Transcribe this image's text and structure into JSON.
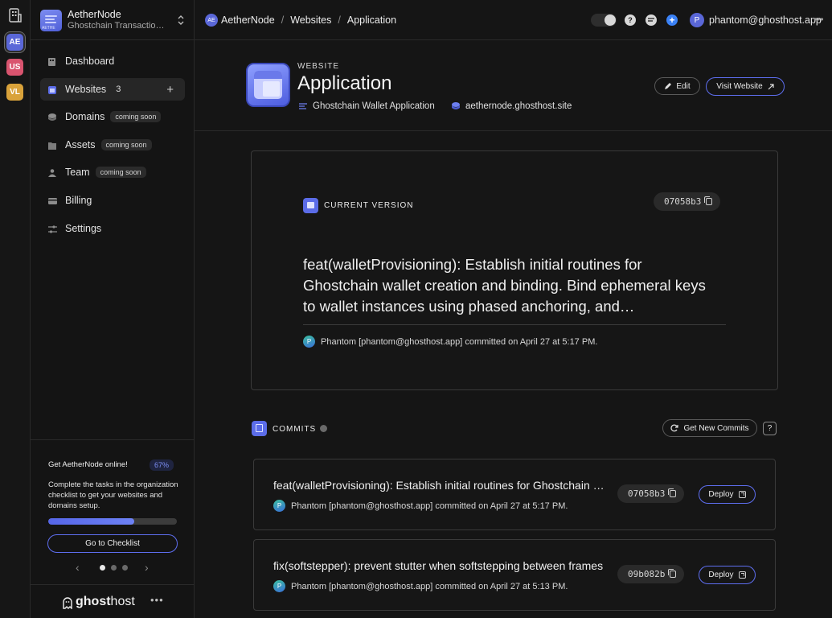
{
  "orgs": [
    {
      "initials": "AE",
      "color": "#5a67d8",
      "selected": true
    },
    {
      "initials": "US",
      "color": "#d9546f",
      "selected": false
    },
    {
      "initials": "VL",
      "color": "#d9a23a",
      "selected": false
    }
  ],
  "workspace": {
    "logo_text": "AETHE",
    "name": "AetherNode",
    "subtitle": "Ghostchain Transaction Indexer"
  },
  "nav": {
    "items": [
      {
        "label": "Dashboard",
        "icon": "dashboard-icon"
      },
      {
        "label": "Websites",
        "count": "3",
        "icon": "websites-icon"
      },
      {
        "label": "Domains",
        "badge": "coming soon",
        "icon": "domains-icon"
      },
      {
        "label": "Assets",
        "badge": "coming soon",
        "icon": "assets-icon"
      },
      {
        "label": "Team",
        "badge": "coming soon",
        "icon": "team-icon"
      },
      {
        "label": "Billing",
        "icon": "billing-icon"
      },
      {
        "label": "Settings",
        "icon": "settings-icon"
      }
    ],
    "active": "Websites"
  },
  "checklist": {
    "title": "Get AetherNode online!",
    "percent": "67%",
    "progress": 0.67,
    "description": "Complete the tasks in the organization checklist to get your websites and domains setup.",
    "button": "Go to Checklist",
    "page_index": 0,
    "page_count": 3
  },
  "brand": {
    "name_bold": "ghost",
    "name_rest": "host"
  },
  "breadcrumb": {
    "org_initials": "AE",
    "items": [
      "AetherNode",
      "Websites",
      "Application"
    ]
  },
  "user": {
    "initial": "P",
    "email": "phantom@ghosthost.app"
  },
  "website": {
    "eyebrow": "WEBSITE",
    "title": "Application",
    "description": "Ghostchain Wallet Application",
    "domain": "aethernode.ghosthost.site",
    "edit_label": "Edit",
    "visit_label": "Visit Website"
  },
  "current_version": {
    "label": "CURRENT VERSION",
    "hash": "07058b3",
    "message": "feat(walletProvisioning): Establish initial routines for Ghostchain wallet creation and binding. Bind ephemeral keys to wallet instances using phased anchoring, and…",
    "author_initial": "P",
    "author_line": "Phantom [phantom@ghosthost.app] committed on April 27 at 5:17 PM."
  },
  "commits": {
    "label": "COMMITS",
    "get_label": "Get New Commits",
    "help_label": "?",
    "deploy_label": "Deploy",
    "items": [
      {
        "message": "feat(walletProvisioning): Establish initial routines for Ghostchain wallet creation and binding",
        "hash": "07058b3",
        "author_initial": "P",
        "author_line": "Phantom [phantom@ghosthost.app] committed on April 27 at 5:17 PM."
      },
      {
        "message": "fix(softstepper): prevent stutter when softstepping between frames",
        "hash": "09b082b",
        "author_initial": "P",
        "author_line": "Phantom [phantom@ghosthost.app] committed on April 27 at 5:13 PM."
      }
    ]
  },
  "colors": {
    "accent": "#5e6ef0",
    "background": "#151515"
  }
}
